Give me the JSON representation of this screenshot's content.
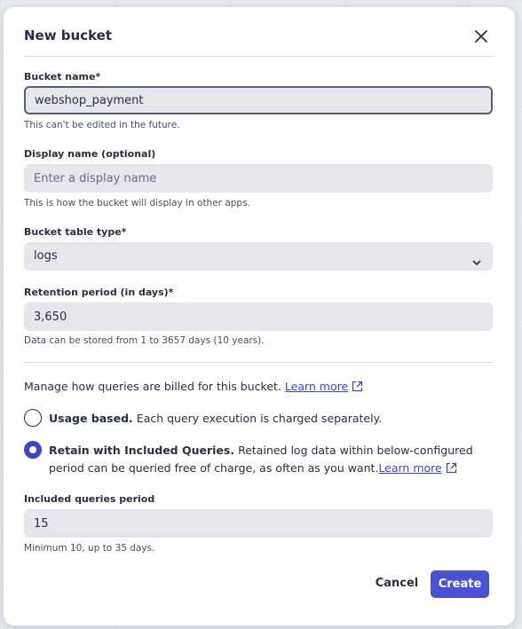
{
  "dialog": {
    "title": "New bucket"
  },
  "bucket_name": {
    "label": "Bucket name*",
    "value": "webshop_payment",
    "hint": "This can't be edited in the future."
  },
  "display_name": {
    "label": "Display name (optional)",
    "placeholder": "Enter a display name",
    "hint": "This is how the bucket will display in other apps."
  },
  "table_type": {
    "label": "Bucket table type*",
    "value": "logs"
  },
  "retention": {
    "label": "Retention period (in days)*",
    "value": "3,650",
    "hint": "Data can be stored from 1 to 3657 days (10 years)."
  },
  "billing": {
    "description": "Manage how queries are billed for this bucket.",
    "learn_more": "Learn more",
    "options": [
      {
        "title": "Usage based.",
        "text": "Each query execution is charged separately.",
        "checked": false
      },
      {
        "title": "Retain with Included Queries.",
        "text": "Retained log data within below-configured period can be queried free of charge, as often as you want.",
        "learn_more": "Learn more",
        "checked": true
      }
    ]
  },
  "included_period": {
    "label": "Included queries period",
    "value": "15",
    "hint": "Minimum 10, up to 35 days."
  },
  "footer": {
    "cancel_label": "Cancel",
    "create_label": "Create"
  },
  "colors": {
    "accent": "#4a52d4",
    "link": "#3d45c9"
  }
}
